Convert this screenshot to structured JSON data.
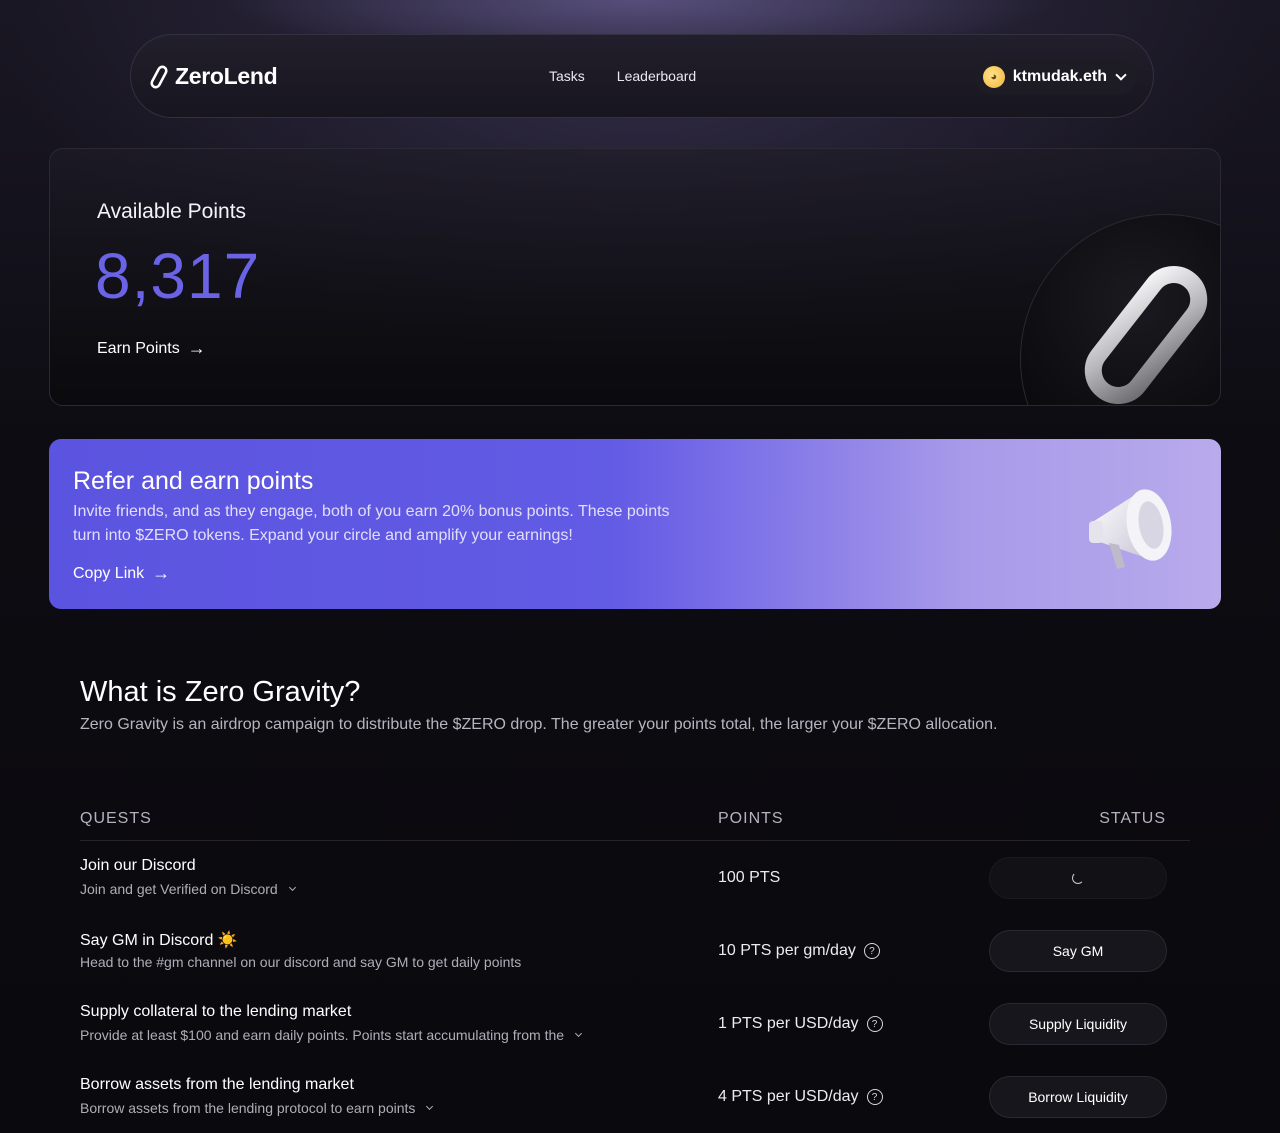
{
  "nav": {
    "brand": "ZeroLend",
    "links": [
      "Tasks",
      "Leaderboard"
    ],
    "user": "ktmudak.eth"
  },
  "points_card": {
    "label": "Available Points",
    "value": "8,317",
    "earn_label": "Earn Points"
  },
  "refer": {
    "title": "Refer and earn points",
    "description": "Invite friends, and as they engage, both of you earn 20% bonus points. These points turn into $ZERO tokens. Expand your circle and amplify your earnings!",
    "link_label": "Copy Link"
  },
  "about": {
    "title": "What is Zero Gravity?",
    "description": "Zero Gravity is an airdrop campaign to distribute the $ZERO drop. The greater your points total, the larger your $ZERO allocation."
  },
  "table": {
    "headers": [
      "QUESTS",
      "POINTS",
      "STATUS"
    ],
    "rows": [
      {
        "title": "Join our Discord",
        "subtitle": "Join and get Verified on Discord",
        "points": "100 PTS",
        "button": ""
      },
      {
        "title": "Say GM in Discord ☀️",
        "subtitle": "Head to the #gm channel on our discord and say GM to get daily points",
        "points": "10 PTS per gm/day",
        "button": "Say GM"
      },
      {
        "title": "Supply collateral to the lending market",
        "subtitle": "Provide at least $100 and earn daily points. Points start accumulating from the",
        "points": "1 PTS per USD/day",
        "button": "Supply Liquidity"
      },
      {
        "title": "Borrow assets from the lending market",
        "subtitle": "Borrow assets from the lending protocol to earn points",
        "points": "4 PTS per USD/day",
        "button": "Borrow Liquidity"
      }
    ]
  }
}
